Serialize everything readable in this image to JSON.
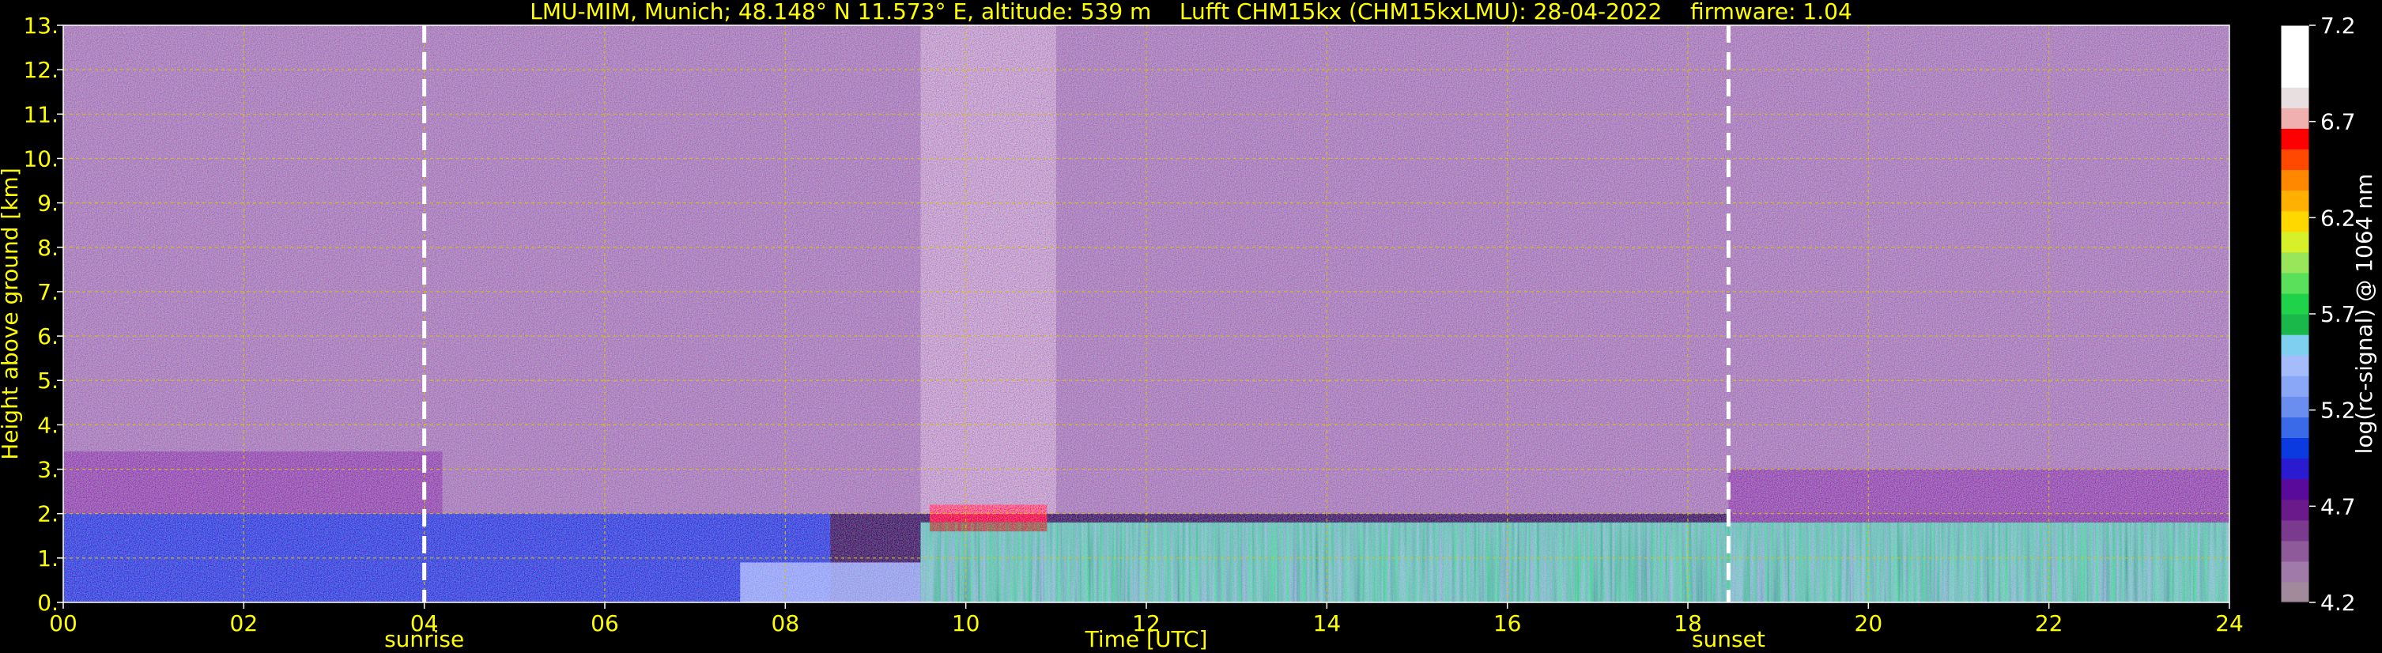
{
  "title": "LMU-MIM, Munich; 48.148° N 11.573° E, altitude: 539 m    Lufft CHM15kx (CHM15kxLMU): 28-04-2022    firmware: 1.04",
  "chart_data": {
    "type": "heatmap",
    "title": "LMU-MIM, Munich; 48.148° N 11.573° E, altitude: 539 m    Lufft CHM15kx (CHM15kxLMU): 28-04-2022    firmware: 1.04",
    "xlabel": "Time [UTC]",
    "ylabel": "Height above ground [km]",
    "xlim": [
      0,
      24
    ],
    "ylim": [
      0,
      13
    ],
    "x_ticks": [
      {
        "value": 0,
        "label": "00"
      },
      {
        "value": 2,
        "label": "02"
      },
      {
        "value": 4,
        "label": "04"
      },
      {
        "value": 6,
        "label": "06"
      },
      {
        "value": 8,
        "label": "08"
      },
      {
        "value": 10,
        "label": "10"
      },
      {
        "value": 12,
        "label": "12"
      },
      {
        "value": 14,
        "label": "14"
      },
      {
        "value": 16,
        "label": "16"
      },
      {
        "value": 18,
        "label": "18"
      },
      {
        "value": 20,
        "label": "20"
      },
      {
        "value": 22,
        "label": "22"
      },
      {
        "value": 24,
        "label": "24"
      }
    ],
    "y_ticks": [
      {
        "value": 0,
        "label": "0."
      },
      {
        "value": 1,
        "label": "1."
      },
      {
        "value": 2,
        "label": "2."
      },
      {
        "value": 3,
        "label": "3."
      },
      {
        "value": 4,
        "label": "4."
      },
      {
        "value": 5,
        "label": "5."
      },
      {
        "value": 6,
        "label": "6."
      },
      {
        "value": 7,
        "label": "7."
      },
      {
        "value": 8,
        "label": "8."
      },
      {
        "value": 9,
        "label": "9."
      },
      {
        "value": 10,
        "label": "10."
      },
      {
        "value": 11,
        "label": "11."
      },
      {
        "value": 12,
        "label": "12."
      },
      {
        "value": 13,
        "label": "13."
      }
    ],
    "grid": true,
    "annotations": [
      {
        "label": "sunrise",
        "x": 4.0
      },
      {
        "label": "sunset",
        "x": 18.45
      }
    ],
    "colorbar": {
      "label": "log(rc-signal) @ 1064 nm",
      "min": 4.2,
      "max": 7.2,
      "ticks": [
        {
          "value": 4.2,
          "label": "4.2"
        },
        {
          "value": 4.7,
          "label": "4.7"
        },
        {
          "value": 5.2,
          "label": "5.2"
        },
        {
          "value": 5.7,
          "label": "5.7"
        },
        {
          "value": 6.2,
          "label": "6.2"
        },
        {
          "value": 6.7,
          "label": "6.7"
        },
        {
          "value": 7.2,
          "label": "7.2"
        }
      ],
      "colors": [
        "#a08a9c",
        "#a07aa8",
        "#8e5a9a",
        "#7a3a8e",
        "#6a1a8a",
        "#5a0a9a",
        "#2a1ad0",
        "#0a3ae0",
        "#3a6ae8",
        "#6a8ef0",
        "#8aa6f6",
        "#a4bcfa",
        "#7fd0f0",
        "#1ab84a",
        "#1fd24a",
        "#5ae05a",
        "#9ae65a",
        "#d6f02a",
        "#ffd800",
        "#ffb000",
        "#ff8800",
        "#ff4800",
        "#ff0000",
        "#f0b0b0",
        "#e8e0e0",
        "#ffffff",
        "#ffffff",
        "#ffffff"
      ]
    },
    "regions": [
      {
        "name": "noise-aloft",
        "t_start": 0,
        "t_end": 24,
        "h_start": 2.0,
        "h_end": 13,
        "level": 4.4
      },
      {
        "name": "residual-layer-night",
        "t_start": 0,
        "t_end": 4.2,
        "h_start": 2.0,
        "h_end": 3.4,
        "level": 4.6
      },
      {
        "name": "boundary-layer-night",
        "t_start": 0,
        "t_end": 8.5,
        "h_start": 0,
        "h_end": 2.0,
        "level": 5.0
      },
      {
        "name": "growing-mixed-layer",
        "t_start": 7.5,
        "t_end": 9.5,
        "h_start": 0,
        "h_end": 0.9,
        "level": 5.3
      },
      {
        "name": "mixed-layer-day",
        "t_start": 9.5,
        "t_end": 24,
        "h_start": 0,
        "h_end": 1.8,
        "level": 5.4
      },
      {
        "name": "cumulus-clouds",
        "t_start": 9.6,
        "t_end": 10.9,
        "h_start": 1.6,
        "h_end": 2.2,
        "level": 6.6
      },
      {
        "name": "residual-layer-evening",
        "t_start": 18.45,
        "t_end": 24,
        "h_start": 1.8,
        "h_end": 3.0,
        "level": 4.6
      }
    ]
  }
}
